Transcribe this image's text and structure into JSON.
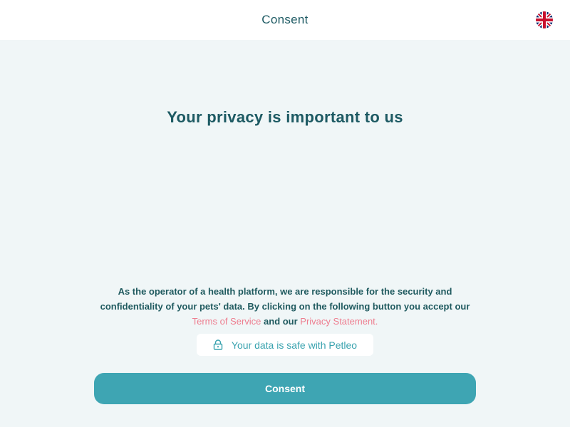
{
  "header": {
    "title": "Consent",
    "language_icon": "uk-flag-icon"
  },
  "main": {
    "headline": "Your privacy is important to us",
    "disclaimer": {
      "text_before": "As the operator of a health platform, we are responsible for the security and confidentiality of your pets' data. By clicking on the following button you accept our ",
      "terms_link": "Terms of Service",
      "text_between": " and our ",
      "privacy_link": "Privacy Statement."
    },
    "safe_badge": {
      "icon": "lock-icon",
      "text": "Your data is safe with Petleo"
    },
    "consent_button": "Consent"
  },
  "colors": {
    "background": "#f0f6f7",
    "primary": "#3ea5b3",
    "text_dark": "#1d5a63",
    "link": "#ee7d8f"
  }
}
